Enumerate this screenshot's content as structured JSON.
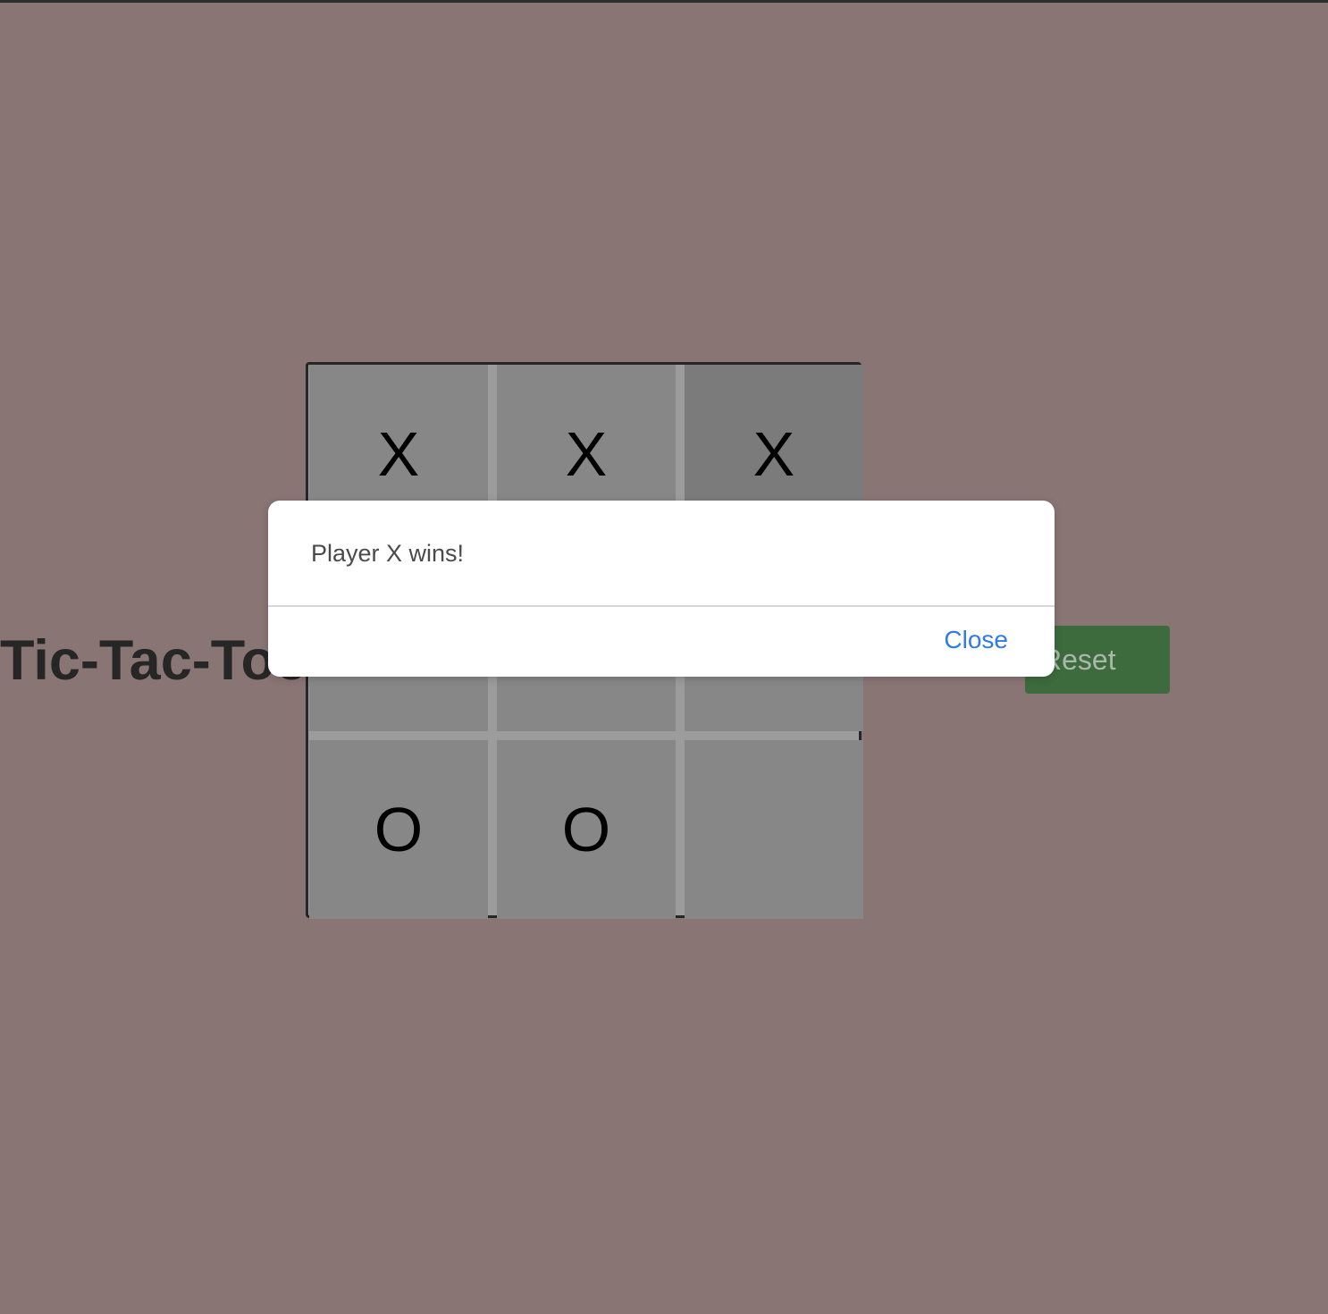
{
  "page": {
    "title": "Tic-Tac-Toe"
  },
  "board": {
    "cells": [
      "X",
      "X",
      "X",
      "",
      "",
      "",
      "O",
      "O",
      ""
    ]
  },
  "controls": {
    "reset_label": "Reset"
  },
  "dialog": {
    "message": "Player X wins!",
    "close_label": "Close"
  },
  "colors": {
    "background": "#8a7575",
    "cell": "#878787",
    "reset_button": "#3d6b3d",
    "dialog_link": "#2f7be8"
  }
}
